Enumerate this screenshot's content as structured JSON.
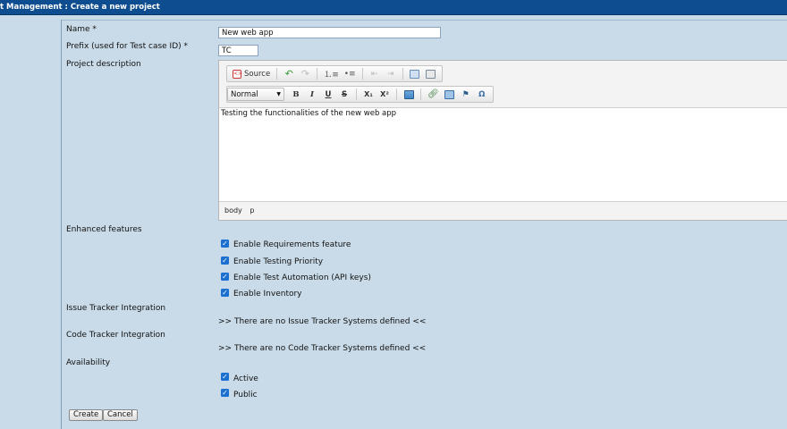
{
  "page": {
    "title": "t Management : Create a new project"
  },
  "form": {
    "name_label": "Name *",
    "name_value": "New web app",
    "prefix_label": "Prefix (used for Test case ID) *",
    "prefix_value": "TC",
    "description_label": "Project description",
    "enhanced_label": "Enhanced features",
    "issue_tracker_label": "Issue Tracker Integration",
    "issue_tracker_msg": ">> There are no Issue Tracker Systems defined <<",
    "code_tracker_label": "Code Tracker Integration",
    "code_tracker_msg": ">> There are no Code Tracker Systems defined <<",
    "availability_label": "Availability"
  },
  "editor": {
    "source_label": "Source",
    "format_value": "Normal",
    "bold": "B",
    "italic": "I",
    "underline": "U",
    "strike": "S",
    "subscript": "X₁",
    "superscript": "X²",
    "omega": "Ω",
    "content": "Testing the functionalities of the new web app",
    "path_body": "body",
    "path_p": "p"
  },
  "features": [
    {
      "label": "Enable Requirements feature",
      "checked": true
    },
    {
      "label": "Enable Testing Priority",
      "checked": true
    },
    {
      "label": "Enable Test Automation (API keys)",
      "checked": true
    },
    {
      "label": "Enable Inventory",
      "checked": true
    }
  ],
  "availability": [
    {
      "label": "Active",
      "checked": true
    },
    {
      "label": "Public",
      "checked": true
    }
  ],
  "buttons": {
    "create": "Create",
    "cancel": "Cancel"
  },
  "colors": {
    "titlebar": "#0e4d8f",
    "page_bg": "#c9dbe8",
    "checkbox": "#1a6fd1"
  }
}
